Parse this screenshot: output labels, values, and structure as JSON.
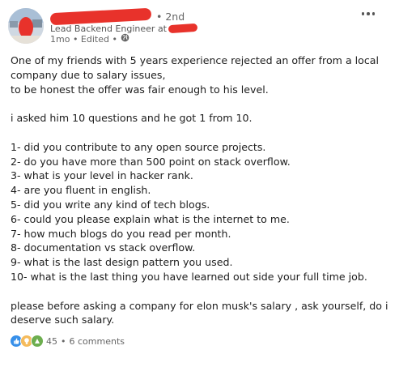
{
  "author": {
    "degree": "• 2nd",
    "headline": "Lead Backend Engineer at",
    "meta": "1mo • Edited •"
  },
  "post": {
    "text": "One of my friends with 5 years experience rejected an offer from a local\ncompany due to salary issues,\nto be honest the offer was fair enough to his level.\n\ni asked him 10 questions and he got 1 from 10.\n\n1- did you contribute to any open source projects.\n2- do you have more than 500 point on stack overflow.\n3- what is your level in hacker rank.\n4- are you fluent in english.\n5- did you write any kind of tech blogs.\n6- could you please explain what is the internet to me.\n7- how much blogs do you read per month.\n8- documentation vs stack overflow.\n9- what is the last design pattern you used.\n10- what is the last thing you have learned out side your full time job.\n\nplease before asking a company for elon musk's salary , ask yourself, do i\ndeserve such salary."
  },
  "social": {
    "reactions": "45",
    "separator": "•",
    "comments": "6 comments"
  },
  "icons": {
    "like": "like-icon",
    "insightful": "insightful-icon",
    "celebrate": "celebrate-icon",
    "globe": "globe-icon",
    "more": "more-options-icon"
  },
  "colors": {
    "redaction": "#e8322b",
    "like": "#378fe9",
    "insightful": "#f5bb5c",
    "celebrate": "#6dae4f"
  }
}
